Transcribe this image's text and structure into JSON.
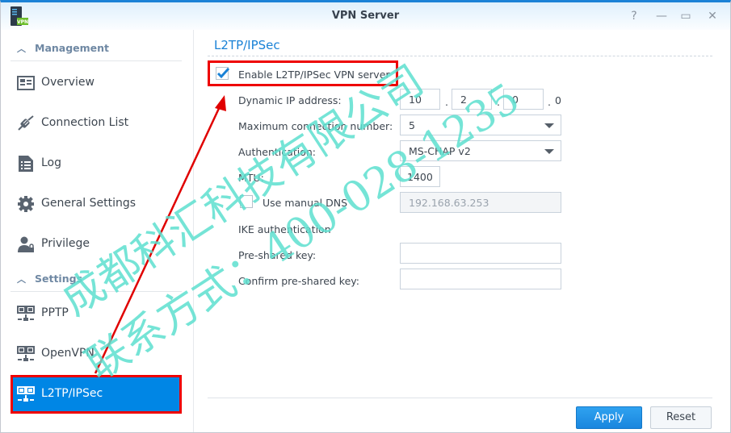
{
  "window": {
    "title": "VPN Server",
    "app_icon": "vpn-server-icon",
    "app_icon_badge": "VPN",
    "controls": [
      {
        "name": "help",
        "glyph": "?"
      },
      {
        "name": "minimize",
        "glyph": "—"
      },
      {
        "name": "maximize",
        "glyph": "▭"
      },
      {
        "name": "close",
        "glyph": "✕"
      }
    ]
  },
  "sidebar": {
    "sections": [
      {
        "label": "Management",
        "items": [
          {
            "label": "Overview",
            "icon": "overview-icon"
          },
          {
            "label": "Connection List",
            "icon": "plug-icon"
          },
          {
            "label": "Log",
            "icon": "log-icon"
          },
          {
            "label": "General Settings",
            "icon": "gear-icon"
          },
          {
            "label": "Privilege",
            "icon": "user-lock-icon"
          }
        ]
      },
      {
        "label": "Settings",
        "items": [
          {
            "label": "PPTP",
            "icon": "network-icon"
          },
          {
            "label": "OpenVPN",
            "icon": "network-icon"
          },
          {
            "label": "L2TP/IPSec",
            "icon": "network-icon",
            "active": true
          }
        ]
      }
    ]
  },
  "main": {
    "section_title": "L2TP/IPSec",
    "enable": {
      "label": "Enable L2TP/IPSec VPN server",
      "checked": true
    },
    "dynamic_ip": {
      "label": "Dynamic IP address:",
      "octets": [
        "10",
        "2",
        "0"
      ],
      "last_octet": "0",
      "separator": "."
    },
    "max_connections": {
      "label": "Maximum connection number:",
      "value": "5"
    },
    "authentication": {
      "label": "Authentication:",
      "value": "MS-CHAP v2"
    },
    "mtu": {
      "label": "MTU:",
      "value": "1400"
    },
    "manual_dns": {
      "label": "Use manual DNS",
      "checked": false,
      "value": "192.168.63.253"
    },
    "ike_heading": "IKE authentication",
    "pre_shared_key": {
      "label": "Pre-shared key:",
      "value": ""
    },
    "confirm_key": {
      "label": "Confirm pre-shared key:",
      "value": ""
    }
  },
  "footer": {
    "apply_label": "Apply",
    "reset_label": "Reset"
  },
  "watermark": {
    "line1": "成都科汇科技有限公司",
    "line2": "联系方式：400-028-1235"
  },
  "annotation": {
    "arrow_color": "#e00000",
    "highlight_color": "#e00000"
  }
}
